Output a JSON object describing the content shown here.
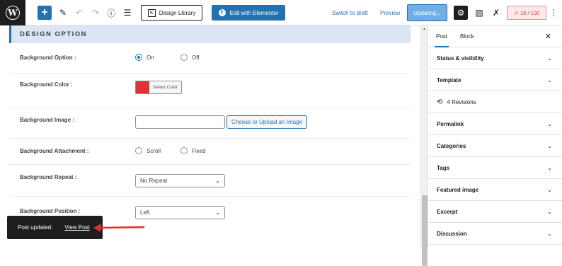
{
  "toolbar": {
    "logo": "W",
    "add_icon": "+",
    "design_library": "Design Library",
    "edit_elementor": "Edit with Elementor",
    "switch_to_draft": "Switch to draft",
    "preview": "Preview",
    "updating": "Updating...",
    "score": "10 / 100",
    "score_icon": "↗",
    "icons": [
      "plus-icon",
      "pencil-icon",
      "undo-icon",
      "redo-icon",
      "info-icon",
      "list-view-icon",
      "gear-icon",
      "page-icon",
      "rank-icon",
      "more-vertical-icon"
    ]
  },
  "design_option": {
    "title": "DESIGN OPTION",
    "rows": {
      "bg_option": {
        "label": "Background Option :",
        "on": "On",
        "off": "Off",
        "selected": "On"
      },
      "bg_color": {
        "label": "Background Color :",
        "button": "Select Color",
        "color": "#dd3333"
      },
      "bg_image": {
        "label": "Background Image :",
        "value": "",
        "upload": "Choose or Upload an Image"
      },
      "bg_attachment": {
        "label": "Background Attachment :",
        "scroll": "Scroll",
        "fixed": "Fixed"
      },
      "bg_repeat": {
        "label": "Background Repeat :",
        "value": "No Repeat"
      },
      "bg_position": {
        "label": "Background Position :",
        "value": "Left"
      }
    }
  },
  "snackbar": {
    "message": "Post updated.",
    "link": "View Post"
  },
  "sidebar": {
    "tabs": [
      "Post",
      "Block"
    ],
    "close": "✕",
    "panels": [
      "Status & visibility",
      "Template",
      "4 Revisions",
      "Permalink",
      "Categories",
      "Tags",
      "Featured image",
      "Excerpt",
      "Discussion"
    ]
  },
  "colors": {
    "accent": "#2271b1",
    "swatch": "#dd3333",
    "score": "#d63638"
  }
}
